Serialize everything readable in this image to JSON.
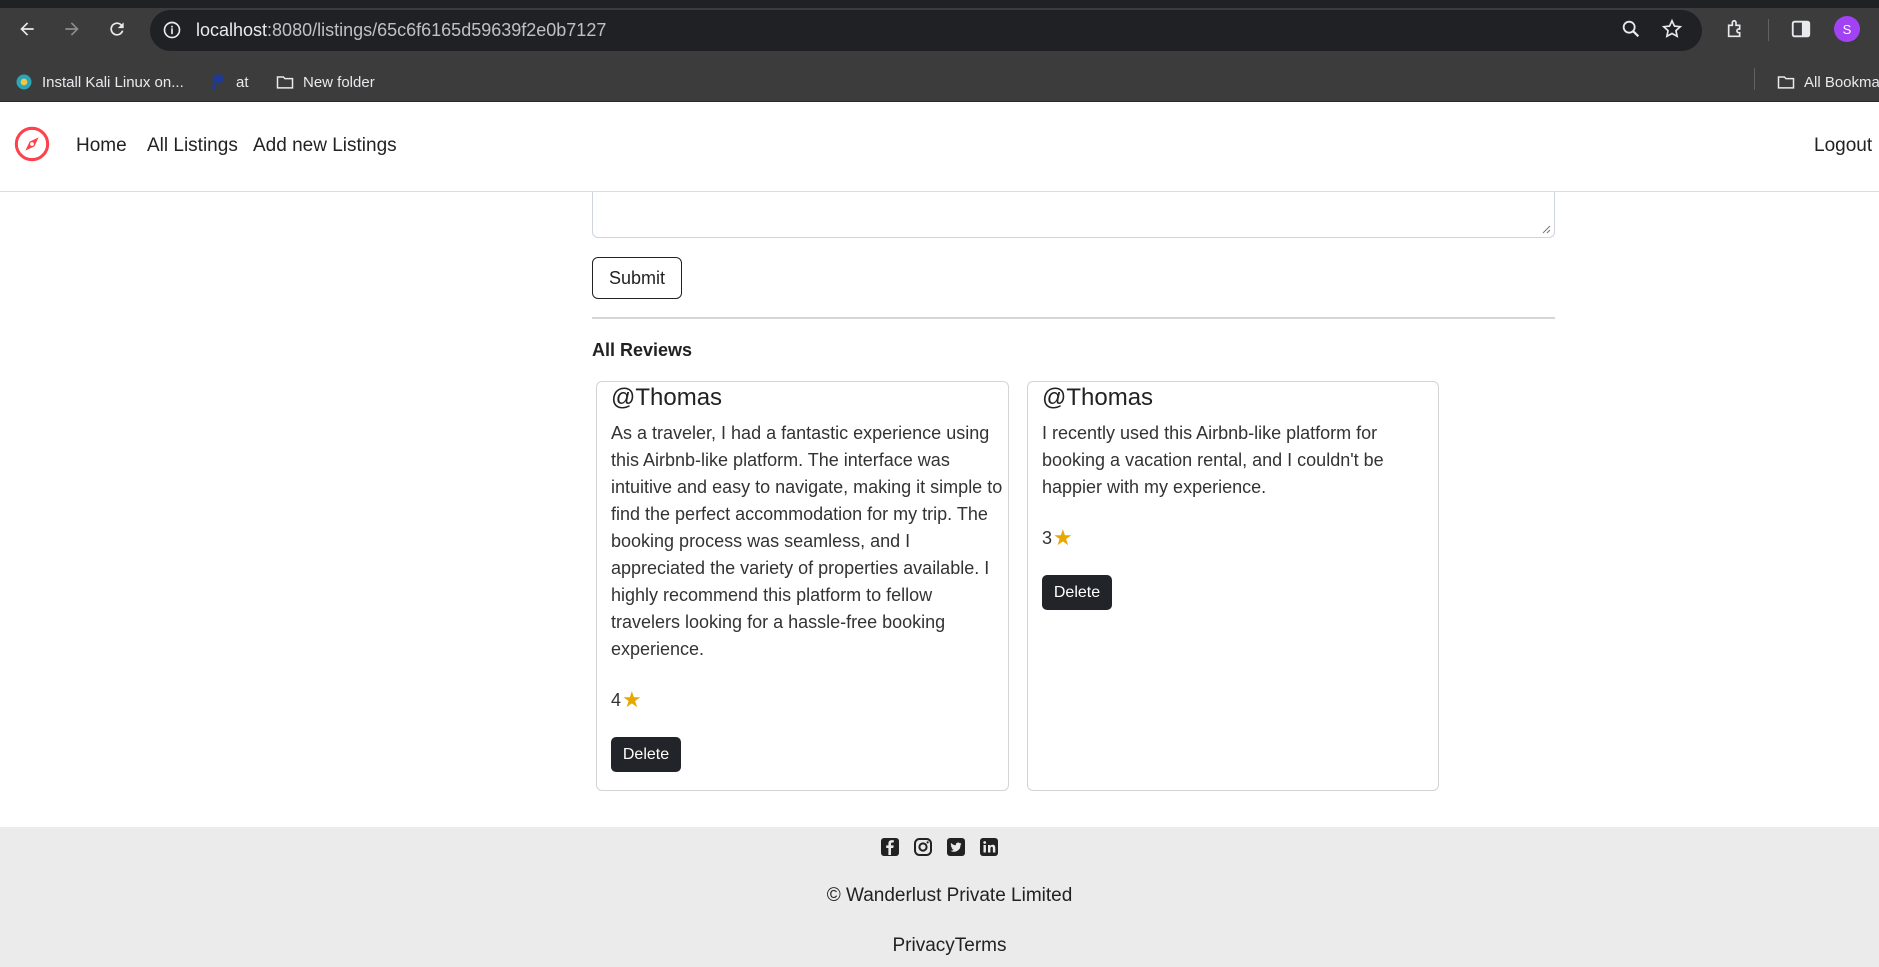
{
  "browser": {
    "url_host": "localhost",
    "url_path": ":8080/listings/65c6f6165d59639f2e0b7127",
    "avatar_letter": "S",
    "bookmarks": [
      {
        "label": "Install Kali Linux on..."
      },
      {
        "label": "at"
      },
      {
        "label": "New folder"
      }
    ],
    "all_bookmarks_label": "All Bookmarks"
  },
  "navbar": {
    "home": "Home",
    "all_listings": "All Listings",
    "add_new": "Add new Listings",
    "logout": "Logout",
    "brand_color": "#fe424d"
  },
  "review_form": {
    "submit_label": "Submit"
  },
  "reviews": {
    "heading": "All Reviews",
    "items": [
      {
        "author": "@Thomas",
        "comment": "As a traveler, I had a fantastic experience using this Airbnb-like platform. The interface was intuitive and easy to navigate, making it simple to find the perfect accommodation for my trip. The booking process was seamless, and I appreciated the variety of properties available. I highly recommend this platform to fellow travelers looking for a hassle-free booking experience.",
        "rating": "4",
        "star": "★",
        "delete_label": "Delete"
      },
      {
        "author": "@Thomas",
        "comment": "I recently used this Airbnb-like platform for booking a vacation rental, and I couldn't be happier with my experience.",
        "rating": "3",
        "star": "★",
        "delete_label": "Delete"
      }
    ]
  },
  "footer": {
    "socials": [
      "facebook-icon",
      "instagram-icon",
      "twitter-icon",
      "linkedin-icon"
    ],
    "copyright": "© Wanderlust Private Limited",
    "privacy": "Privacy",
    "terms": "Terms"
  }
}
